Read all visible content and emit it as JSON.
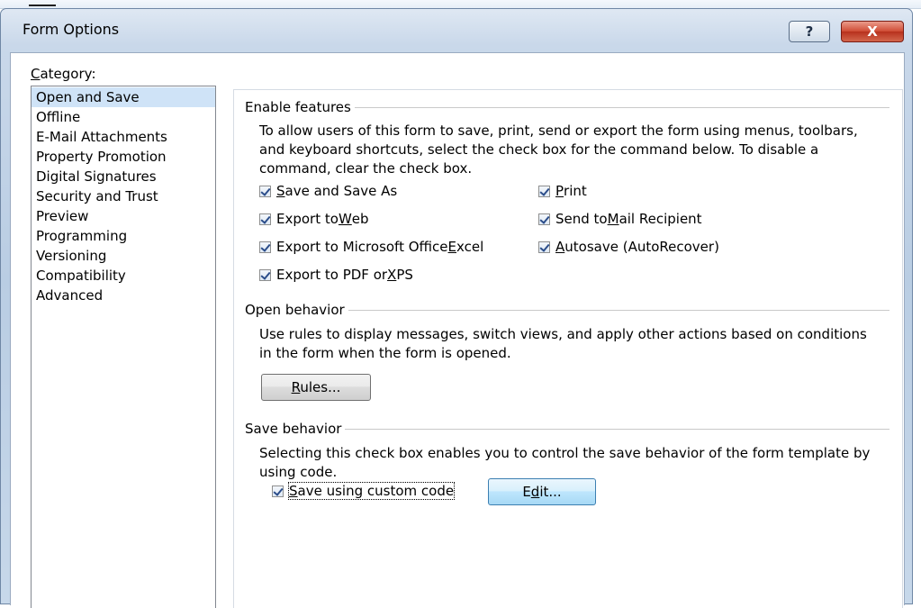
{
  "window": {
    "title": "Form Options",
    "help_label": "?",
    "close_label": "X"
  },
  "category": {
    "label_hotkey": "C",
    "label_rest": "ategory:",
    "items": [
      "Open and Save",
      "Offline",
      "E-Mail Attachments",
      "Property Promotion",
      "Digital Signatures",
      "Security and Trust",
      "Preview",
      "Programming",
      "Versioning",
      "Compatibility",
      "Advanced"
    ],
    "selected_index": 0
  },
  "enable_features": {
    "header": "Enable features",
    "description": "To allow users of this form to save, print, send or export the form using menus, toolbars, and keyboard shortcuts, select the check box for the command below.  To disable a command, clear the check box.",
    "checkboxes": [
      {
        "pre": "",
        "hot": "S",
        "post": "ave and Save As",
        "checked": true
      },
      {
        "pre": "Export to ",
        "hot": "W",
        "post": "eb",
        "checked": true
      },
      {
        "pre": "Export to Microsoft Office ",
        "hot": "E",
        "post": "xcel",
        "checked": true
      },
      {
        "pre": "Export to PDF or ",
        "hot": "X",
        "post": "PS",
        "checked": true
      },
      {
        "pre": "",
        "hot": "P",
        "post": "rint",
        "checked": true
      },
      {
        "pre": "Send to ",
        "hot": "M",
        "post": "ail Recipient",
        "checked": true
      },
      {
        "pre": "",
        "hot": "A",
        "post": "utosave (AutoRecover)",
        "checked": true
      }
    ]
  },
  "open_behavior": {
    "header": "Open behavior",
    "description": "Use rules to display messages, switch views, and apply other actions based on conditions in the form when the form is opened.",
    "rules_button": {
      "hot": "R",
      "post": "ules..."
    }
  },
  "save_behavior": {
    "header": "Save behavior",
    "description": "Selecting this check box enables you to control the save behavior of the form template by using code.",
    "custom_code": {
      "hot": "S",
      "post": "ave using custom code",
      "checked": true
    },
    "edit_button": {
      "pre": "E",
      "hot": "d",
      "post": "it..."
    }
  },
  "colors": {
    "selection": "#cfe3f7",
    "close_button": "#c7402a"
  }
}
